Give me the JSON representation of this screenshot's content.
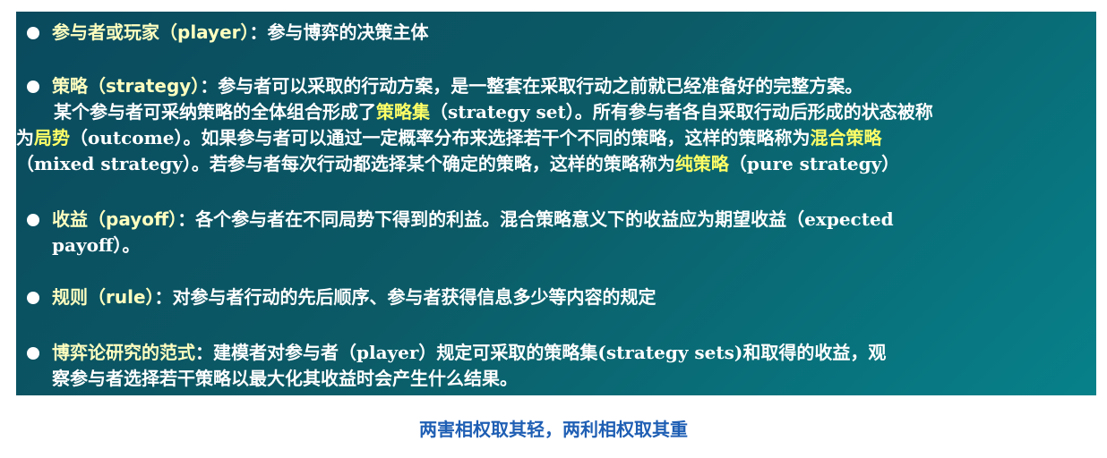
{
  "items": [
    {
      "term": "参与者或玩家（player）",
      "text": "：参与博弈的决策主体"
    },
    {
      "term": "策略（strategy）",
      "text": "：参与者可以采取的行动方案，是一整套在采取行动之前就已经准备好的完整方案。",
      "detail": {
        "l1a": "某个参与者可采纳策略的全体组合形成了",
        "l1b": "策略集",
        "l1c": "（strategy set）。所有参与者各自采取行动后形成的状态被称",
        "l2a": "为",
        "l2b": "局势",
        "l2c": "（outcome）。如果参与者可以通过一定概率分布来选择若干个不同的策略，这样的策略称为",
        "l2d": "混合策略",
        "l3a": "（mixed strategy）。若参与者每次行动都选择某个确定的策略，这样的策略称为",
        "l3b": "纯策略",
        "l3c": "（pure strategy）"
      }
    },
    {
      "term": "收益（payoff）",
      "text": "：各个参与者在不同局势下得到的利益。混合策略意义下的收益应为期望收益（expected",
      "text2": "payoff）。"
    },
    {
      "term": "规则（rule）",
      "text": "：对参与者行动的先后顺序、参与者获得信息多少等内容的规定"
    },
    {
      "term": "博弈论研究的范式",
      "text": "：建模者对参与者（player）规定可采取的策略集(strategy sets)和取得的收益，观",
      "text2": "察参与者选择若干策略以最大化其收益时会产生什么结果。"
    }
  ],
  "caption": "两害相权取其轻，两利相权取其重"
}
